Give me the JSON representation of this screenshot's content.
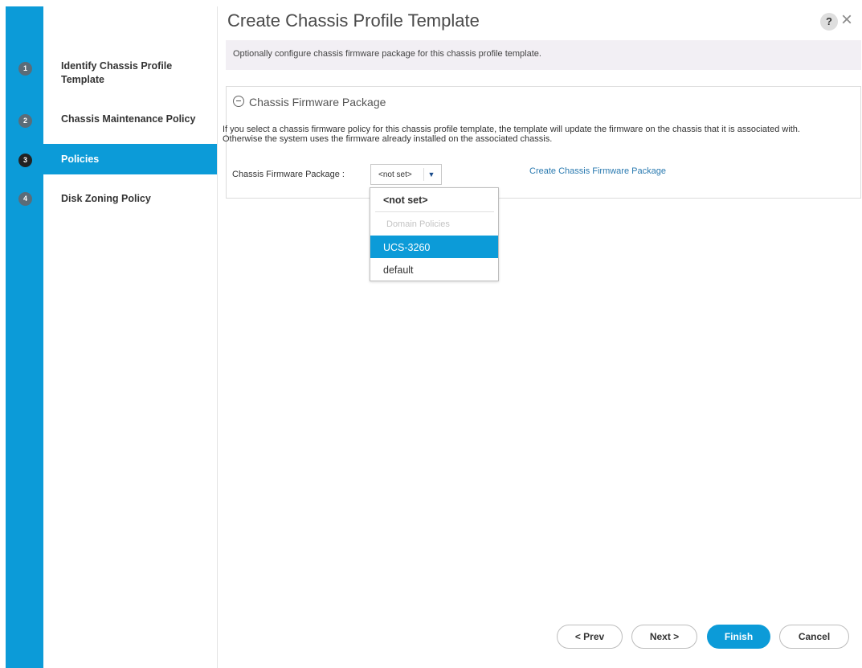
{
  "title": "Create Chassis Profile Template",
  "help": "?",
  "close": "×",
  "banner": "Optionally configure chassis firmware package for this chassis profile template.",
  "steps": [
    {
      "num": "1",
      "label": "Identify Chassis Profile Template",
      "active": false
    },
    {
      "num": "2",
      "label": "Chassis Maintenance Policy",
      "active": false
    },
    {
      "num": "3",
      "label": "Policies",
      "active": true
    },
    {
      "num": "4",
      "label": "Disk Zoning Policy",
      "active": false
    }
  ],
  "panel": {
    "heading": "Chassis Firmware Package",
    "desc_line1": "If you select a chassis firmware policy for this chassis profile template, the template will update the firmware on the chassis that it is associated with.",
    "desc_line2": "Otherwise the system uses the firmware already installed on the associated chassis.",
    "field_label": "Chassis Firmware Package :",
    "select_value": "<not set>",
    "create_link": "Create Chassis Firmware Package"
  },
  "dropdown": {
    "options": [
      "<not set>",
      "Domain Policies",
      "UCS-3260",
      "default"
    ],
    "selected": "UCS-3260"
  },
  "buttons": {
    "prev": "< Prev",
    "next": "Next >",
    "finish": "Finish",
    "cancel": "Cancel"
  },
  "colors": {
    "accent": "#0c9bd8",
    "rail": "#0c9bd8"
  }
}
